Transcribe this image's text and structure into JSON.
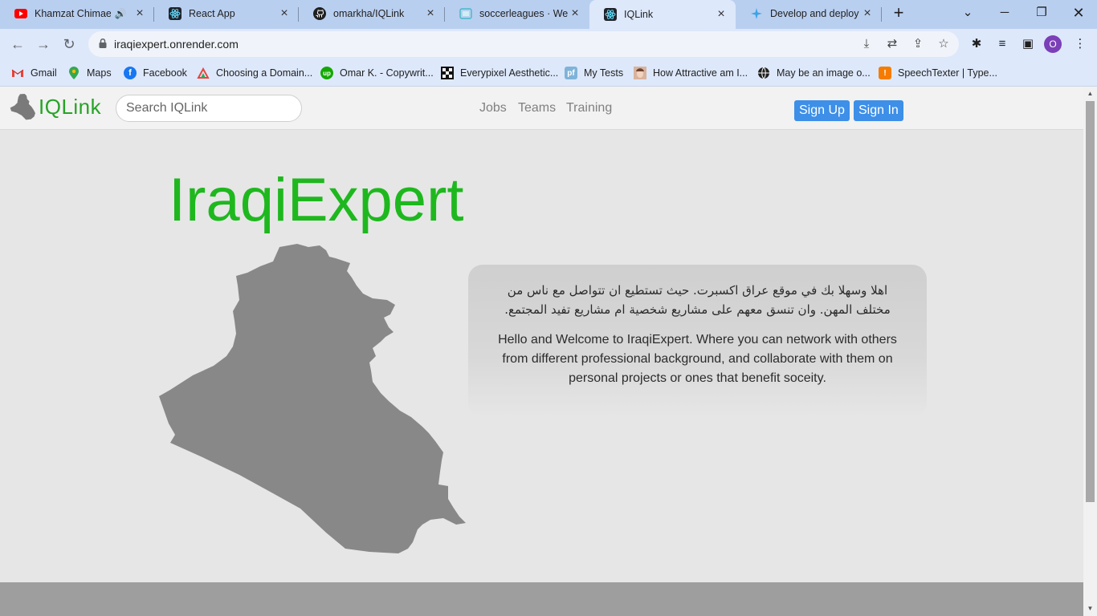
{
  "browser": {
    "tabs": [
      {
        "title": "Khamzat Chimaev",
        "icon": "youtube-icon",
        "audio": true,
        "active": false
      },
      {
        "title": "React App",
        "icon": "react-icon",
        "active": false
      },
      {
        "title": "omarkha/IQLink",
        "icon": "github-icon",
        "active": false
      },
      {
        "title": "soccerleagues · Web",
        "icon": "web-icon",
        "active": false
      },
      {
        "title": "IQLink",
        "icon": "react-icon",
        "active": true
      },
      {
        "title": "Develop and deploy",
        "icon": "render-icon",
        "active": false
      }
    ],
    "new_tab": "+",
    "address": {
      "url": "iraqiexpert.onrender.com"
    },
    "profile_initial": "O",
    "bookmarks": [
      {
        "label": "Gmail",
        "icon": "gmail-icon"
      },
      {
        "label": "Maps",
        "icon": "maps-icon"
      },
      {
        "label": "Facebook",
        "icon": "facebook-icon"
      },
      {
        "label": "Choosing a Domain...",
        "icon": "domain-icon"
      },
      {
        "label": "Omar K. - Copywrit...",
        "icon": "upwork-icon"
      },
      {
        "label": "Everypixel Aesthetic...",
        "icon": "everypixel-icon"
      },
      {
        "label": "My Tests",
        "icon": "pf-icon"
      },
      {
        "label": "How Attractive am I...",
        "icon": "face-icon"
      },
      {
        "label": "May be an image o...",
        "icon": "globe-icon"
      },
      {
        "label": "SpeechTexter | Type...",
        "icon": "speechtexter-icon"
      }
    ]
  },
  "site": {
    "logo_text": "IQLink",
    "search_placeholder": "Search IQLink",
    "nav": {
      "jobs": "Jobs",
      "teams": "Teams",
      "training": "Training"
    },
    "signup": "Sign Up",
    "signin": "Sign In",
    "hero_title": "IraqiExpert",
    "welcome_ar": "اهلا وسهلا بك في موقع عراق اكسبرت. حيث تستطيع ان تتواصل مع ناس من مختلف المهن. وان تنسق معهم على مشاريع شخصية ام مشاريع تفيد المجتمع.",
    "welcome_en": "Hello and Welcome to IraqiExpert. Where you can network with others from different professional background, and collaborate with them on personal projects or ones that benefit soceity."
  },
  "colors": {
    "brand_green": "#1eb81e",
    "button_blue": "#3d8fe8",
    "map_gray": "#888888",
    "footer_gray": "#9e9e9e"
  }
}
